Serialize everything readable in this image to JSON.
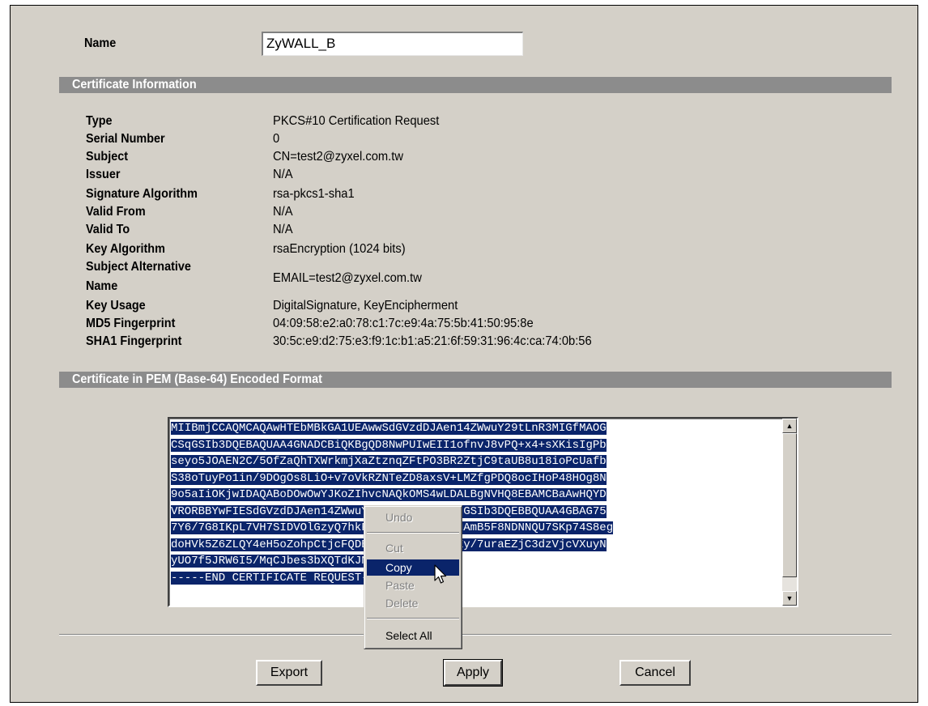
{
  "name_label": "Name",
  "name_value": "ZyWALL_B",
  "certificate_info": {
    "title": "Certificate Information",
    "rows": [
      {
        "label": "Type",
        "value": "PKCS#10 Certification Request"
      },
      {
        "label": "Serial Number",
        "value": "0"
      },
      {
        "label": "Subject",
        "value": "CN=test2@zyxel.com.tw"
      },
      {
        "label": "Issuer",
        "value": "N/A"
      },
      {
        "label": "Signature Algorithm",
        "value": "rsa-pkcs1-sha1"
      },
      {
        "label": "Valid From",
        "value": "N/A"
      },
      {
        "label": "Valid To",
        "value": "N/A"
      },
      {
        "label": "Key Algorithm",
        "value": "rsaEncryption (1024 bits)"
      },
      {
        "label_line1": "Subject Alternative",
        "label_line2": "Name",
        "value": "EMAIL=test2@zyxel.com.tw"
      },
      {
        "label": "Key Usage",
        "value": "DigitalSignature, KeyEncipherment"
      },
      {
        "label": "MD5 Fingerprint",
        "value": "04:09:58:e2:a0:78:c1:7c:e9:4a:75:5b:41:50:95:8e"
      },
      {
        "label": "SHA1 Fingerprint",
        "value": "30:5c:e9:d2:75:e3:f9:1c:b1:a5:21:6f:59:31:96:4c:ca:74:0b:56"
      }
    ]
  },
  "pem": {
    "title": "Certificate in PEM (Base-64) Encoded Format",
    "lines": [
      "MIIBmjCCAQMCAQAwHTEbMBkGA1UEAwwSdGVzdDJAen14ZWwuY29tLnR3MIGfMAOG",
      "CSqGSIb3DQEBAQUAA4GNADCBiQKBgQD8NwPUIwEII1ofnvJ8vPQ+x4+sXKisIgPb",
      "seyo5JOAEN2C/5OfZaQhTXWrkmjXaZtznqZFtPO3BR2ZtjC9taUB8u18ioPcUafb",
      "S38oTuyPo1in/9DOgOs8LiO+v7oVkRZNTeZD8axsV+LMZfgPDQ8ocIHoP48HOg8N",
      "9o5aIiOKjwIDAQABoDOwOwYJKoZIhvcNAQkOMS4wLDALBgNVHQ8EBAMCBaAwHQYD",
      "VRORBBYwFIESdGVzdDJAen14ZWwuY29tLnR3MAOGCSqGSIb3DQEBBQUAA4GBAG75",
      "7Y6/7G8IKpL7VH7SIDVOlGzyQ7hkFPHyYCbf94v6/ngAmB5F8NDNNQU7SKp74S8eg",
      "doHVk5Z6ZLQY4eH5oZohpCtjcFQDBn9MgoYWUFlSdCEy/7uraEZjC3dzVjcVXuyN",
      "yUO7f5JRW6I5/MqCJbes3bXQTdKJN4a7nUA4TZ",
      "-----END CERTIFICATE REQUEST-----"
    ]
  },
  "context_menu": {
    "undo": "Undo",
    "cut": "Cut",
    "copy": "Copy",
    "paste": "Paste",
    "delete": "Delete",
    "select_all": "Select All"
  },
  "buttons": {
    "export": "Export",
    "apply": "Apply",
    "cancel": "Cancel"
  },
  "icons": {
    "scroll_up": "scroll-up-arrow-icon",
    "scroll_down": "scroll-down-arrow-icon",
    "cursor": "mouse-pointer-icon"
  },
  "colors": {
    "panel_bg": "#d4d0c8",
    "section_bar": "#8c8c8c",
    "selection": "#0a246a"
  }
}
